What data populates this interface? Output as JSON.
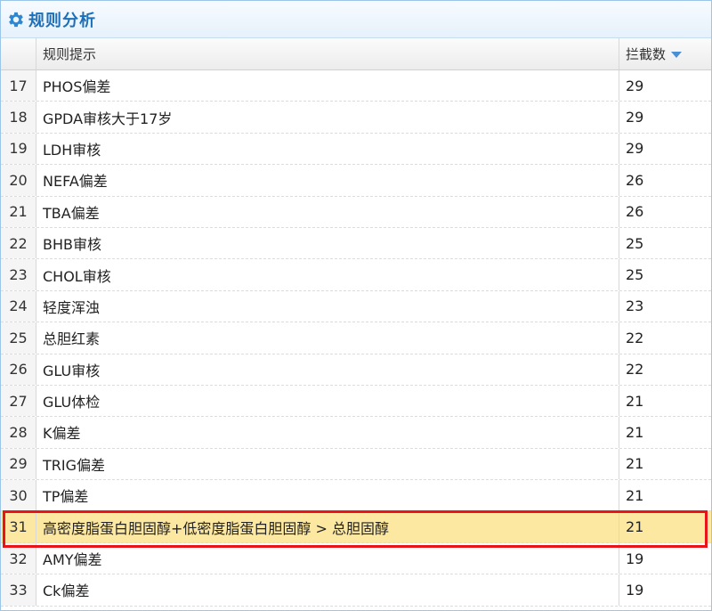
{
  "panel": {
    "title": "规则分析",
    "icon": "gear-icon",
    "accent_color": "#1d6fb8"
  },
  "table": {
    "columns": {
      "rule": "规则提示",
      "count": "拦截数"
    },
    "sort": {
      "column": "count",
      "direction": "desc"
    },
    "rows": [
      {
        "num": "17",
        "rule": "PHOS偏差",
        "count": "29"
      },
      {
        "num": "18",
        "rule": "GPDA审核大于17岁",
        "count": "29"
      },
      {
        "num": "19",
        "rule": "LDH审核",
        "count": "29"
      },
      {
        "num": "20",
        "rule": "NEFA偏差",
        "count": "26"
      },
      {
        "num": "21",
        "rule": "TBA偏差",
        "count": "26"
      },
      {
        "num": "22",
        "rule": "BHB审核",
        "count": "25"
      },
      {
        "num": "23",
        "rule": "CHOL审核",
        "count": "25"
      },
      {
        "num": "24",
        "rule": "轻度浑浊",
        "count": "23"
      },
      {
        "num": "25",
        "rule": "总胆红素",
        "count": "22"
      },
      {
        "num": "26",
        "rule": "GLU审核",
        "count": "22"
      },
      {
        "num": "27",
        "rule": "GLU体检",
        "count": "21"
      },
      {
        "num": "28",
        "rule": "K偏差",
        "count": "21"
      },
      {
        "num": "29",
        "rule": "TRIG偏差",
        "count": "21"
      },
      {
        "num": "30",
        "rule": "TP偏差",
        "count": "21"
      },
      {
        "num": "31",
        "rule": "高密度脂蛋白胆固醇+低密度脂蛋白胆固醇 > 总胆固醇",
        "count": "21",
        "selected": true
      },
      {
        "num": "32",
        "rule": "AMY偏差",
        "count": "19"
      },
      {
        "num": "33",
        "rule": "Ck偏差",
        "count": "19"
      }
    ],
    "selected_row_color": "#fde8a2",
    "highlight_color": "#e8141a"
  }
}
